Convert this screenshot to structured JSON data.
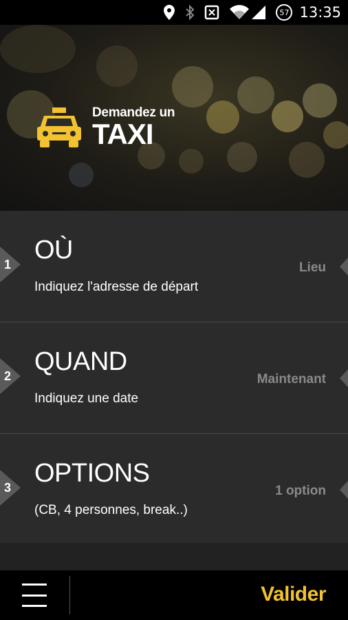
{
  "status_bar": {
    "time": "13:35",
    "battery_level": "57",
    "icons": [
      "location-icon",
      "bluetooth-icon",
      "nfc-icon",
      "wifi-icon",
      "signal-icon",
      "battery-icon"
    ]
  },
  "header": {
    "logo_line1": "Demandez un",
    "logo_line2": "TAXI",
    "logo_icon": "taxi-icon",
    "accent_color": "#f2c230"
  },
  "rows": [
    {
      "number": "1",
      "title": "OÙ",
      "subtitle": "Indiquez l'adresse de départ",
      "value": "Lieu"
    },
    {
      "number": "2",
      "title": "QUAND",
      "subtitle": "Indiquez une date",
      "value": "Maintenant"
    },
    {
      "number": "3",
      "title": "OPTIONS",
      "subtitle": "(CB, 4 personnes, break..)",
      "value": "1 option"
    }
  ],
  "footer": {
    "menu_icon": "hamburger-menu-icon",
    "submit_label": "Valider",
    "submit_color": "#f2c230"
  }
}
